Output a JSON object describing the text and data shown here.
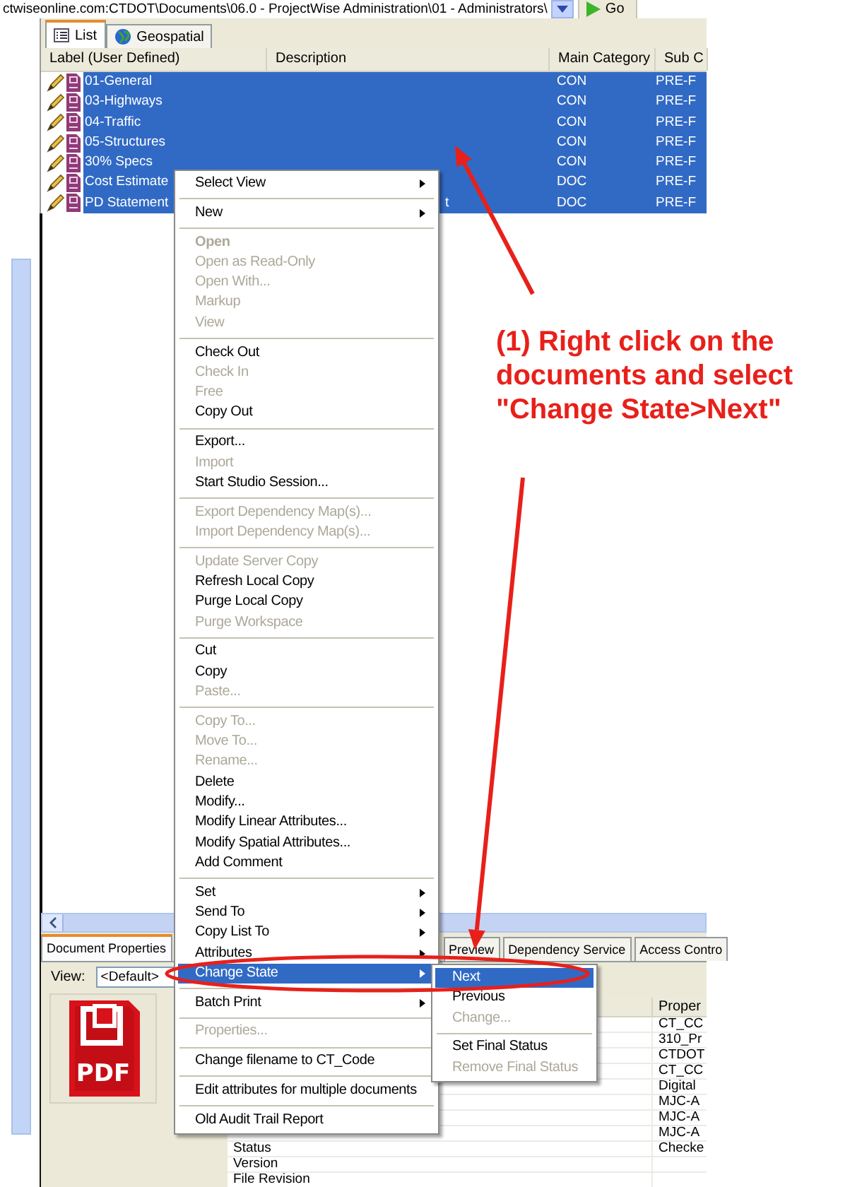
{
  "address_bar": {
    "path": "ctwiseonline.com:CTDOT\\Documents\\06.0 - ProjectWise Administration\\01 - Administrators\\",
    "go_label": "Go"
  },
  "view_tabs": [
    {
      "label": "List",
      "selected": true
    },
    {
      "label": "Geospatial",
      "selected": false
    }
  ],
  "document_list": {
    "columns": [
      "Label (User Defined)",
      "Description",
      "Main Category",
      "Sub C"
    ],
    "rows": [
      {
        "label": "01-General",
        "main_category": "CON",
        "sub_category": "PRE-F",
        "selected": true
      },
      {
        "label": "03-Highways",
        "main_category": "CON",
        "sub_category": "PRE-F",
        "selected": true
      },
      {
        "label": "04-Traffic",
        "main_category": "CON",
        "sub_category": "PRE-F",
        "selected": true
      },
      {
        "label": "05-Structures",
        "main_category": "CON",
        "sub_category": "PRE-F",
        "selected": true
      },
      {
        "label": "30% Specs",
        "main_category": "CON",
        "sub_category": "PRE-F",
        "selected": true
      },
      {
        "label": "Cost Estimate",
        "main_category": "DOC",
        "sub_category": "PRE-F",
        "selected": true
      },
      {
        "label": "PD Statement",
        "description": "t",
        "main_category": "DOC",
        "sub_category": "PRE-F",
        "selected": true
      }
    ]
  },
  "bottom_panel": {
    "tabs": [
      {
        "label": "Document Properties",
        "selected": true
      },
      {
        "label": "Preview",
        "selected": false
      },
      {
        "label": "Dependency Service",
        "selected": false
      },
      {
        "label": "Access Contro",
        "selected": false
      }
    ],
    "view": {
      "label": "View:",
      "value": "<Default>"
    },
    "preview_icon_label": "PDF",
    "properties": {
      "header": "Proper",
      "rows": [
        {
          "value": "CT_CC"
        },
        {
          "value": "310_Pr"
        },
        {
          "value": "CTDOT"
        },
        {
          "value": "CT_CC"
        },
        {
          "value": "Digital"
        },
        {
          "value": "MJC-A"
        },
        {
          "value": "MJC-A"
        },
        {
          "value": "MJC-A"
        },
        {
          "name": "Status",
          "value": "Checke"
        },
        {
          "name": "Version"
        },
        {
          "name": "File Revision"
        }
      ]
    }
  },
  "context_menu": {
    "items": [
      {
        "kind": "item",
        "label": "Select View",
        "disabled": false,
        "default": false,
        "submenu": true,
        "selected": false
      },
      {
        "kind": "separator"
      },
      {
        "kind": "item",
        "label": "New",
        "disabled": false,
        "default": false,
        "submenu": true,
        "selected": false
      },
      {
        "kind": "separator"
      },
      {
        "kind": "item",
        "label": "Open",
        "disabled": true,
        "default": true,
        "submenu": false,
        "selected": false
      },
      {
        "kind": "item",
        "label": "Open as Read-Only",
        "disabled": true,
        "default": false,
        "submenu": false,
        "selected": false
      },
      {
        "kind": "item",
        "label": "Open With...",
        "disabled": true,
        "default": false,
        "submenu": false,
        "selected": false
      },
      {
        "kind": "item",
        "label": "Markup",
        "disabled": true,
        "default": false,
        "submenu": false,
        "selected": false
      },
      {
        "kind": "item",
        "label": "View",
        "disabled": true,
        "default": false,
        "submenu": false,
        "selected": false
      },
      {
        "kind": "separator"
      },
      {
        "kind": "item",
        "label": "Check Out",
        "disabled": false,
        "default": false,
        "submenu": false,
        "selected": false
      },
      {
        "kind": "item",
        "label": "Check In",
        "disabled": true,
        "default": false,
        "submenu": false,
        "selected": false
      },
      {
        "kind": "item",
        "label": "Free",
        "disabled": true,
        "default": false,
        "submenu": false,
        "selected": false
      },
      {
        "kind": "item",
        "label": "Copy Out",
        "disabled": false,
        "default": false,
        "submenu": false,
        "selected": false
      },
      {
        "kind": "separator"
      },
      {
        "kind": "item",
        "label": "Export...",
        "disabled": false,
        "default": false,
        "submenu": false,
        "selected": false
      },
      {
        "kind": "item",
        "label": "Import",
        "disabled": true,
        "default": false,
        "submenu": false,
        "selected": false
      },
      {
        "kind": "item",
        "label": "Start Studio Session...",
        "disabled": false,
        "default": false,
        "submenu": false,
        "selected": false
      },
      {
        "kind": "separator"
      },
      {
        "kind": "item",
        "label": "Export Dependency Map(s)...",
        "disabled": true,
        "default": false,
        "submenu": false,
        "selected": false
      },
      {
        "kind": "item",
        "label": "Import Dependency Map(s)...",
        "disabled": true,
        "default": false,
        "submenu": false,
        "selected": false
      },
      {
        "kind": "separator"
      },
      {
        "kind": "item",
        "label": "Update Server Copy",
        "disabled": true,
        "default": false,
        "submenu": false,
        "selected": false
      },
      {
        "kind": "item",
        "label": "Refresh Local Copy",
        "disabled": false,
        "default": false,
        "submenu": false,
        "selected": false
      },
      {
        "kind": "item",
        "label": "Purge Local Copy",
        "disabled": false,
        "default": false,
        "submenu": false,
        "selected": false
      },
      {
        "kind": "item",
        "label": "Purge Workspace",
        "disabled": true,
        "default": false,
        "submenu": false,
        "selected": false
      },
      {
        "kind": "separator"
      },
      {
        "kind": "item",
        "label": "Cut",
        "disabled": false,
        "default": false,
        "submenu": false,
        "selected": false
      },
      {
        "kind": "item",
        "label": "Copy",
        "disabled": false,
        "default": false,
        "submenu": false,
        "selected": false
      },
      {
        "kind": "item",
        "label": "Paste...",
        "disabled": true,
        "default": false,
        "submenu": false,
        "selected": false
      },
      {
        "kind": "separator"
      },
      {
        "kind": "item",
        "label": "Copy To...",
        "disabled": true,
        "default": false,
        "submenu": false,
        "selected": false
      },
      {
        "kind": "item",
        "label": "Move To...",
        "disabled": true,
        "default": false,
        "submenu": false,
        "selected": false
      },
      {
        "kind": "item",
        "label": "Rename...",
        "disabled": true,
        "default": false,
        "submenu": false,
        "selected": false
      },
      {
        "kind": "item",
        "label": "Delete",
        "disabled": false,
        "default": false,
        "submenu": false,
        "selected": false
      },
      {
        "kind": "item",
        "label": "Modify...",
        "disabled": false,
        "default": false,
        "submenu": false,
        "selected": false
      },
      {
        "kind": "item",
        "label": "Modify Linear Attributes...",
        "disabled": false,
        "default": false,
        "submenu": false,
        "selected": false
      },
      {
        "kind": "item",
        "label": "Modify Spatial Attributes...",
        "disabled": false,
        "default": false,
        "submenu": false,
        "selected": false
      },
      {
        "kind": "item",
        "label": "Add Comment",
        "disabled": false,
        "default": false,
        "submenu": false,
        "selected": false
      },
      {
        "kind": "separator"
      },
      {
        "kind": "item",
        "label": "Set",
        "disabled": false,
        "default": false,
        "submenu": true,
        "selected": false
      },
      {
        "kind": "item",
        "label": "Send To",
        "disabled": false,
        "default": false,
        "submenu": true,
        "selected": false
      },
      {
        "kind": "item",
        "label": "Copy List To",
        "disabled": false,
        "default": false,
        "submenu": true,
        "selected": false
      },
      {
        "kind": "item",
        "label": "Attributes",
        "disabled": false,
        "default": false,
        "submenu": true,
        "selected": false
      },
      {
        "kind": "item",
        "label": "Change State",
        "disabled": false,
        "default": false,
        "submenu": true,
        "selected": true
      },
      {
        "kind": "separator"
      },
      {
        "kind": "item",
        "label": "Batch Print",
        "disabled": false,
        "default": false,
        "submenu": true,
        "selected": false
      },
      {
        "kind": "separator"
      },
      {
        "kind": "item",
        "label": "Properties...",
        "disabled": true,
        "default": false,
        "submenu": false,
        "selected": false
      },
      {
        "kind": "separator"
      },
      {
        "kind": "item",
        "label": "Change filename to CT_Code",
        "disabled": false,
        "default": false,
        "submenu": false,
        "selected": false
      },
      {
        "kind": "separator"
      },
      {
        "kind": "item",
        "label": "Edit attributes for multiple documents",
        "disabled": false,
        "default": false,
        "submenu": false,
        "selected": false
      },
      {
        "kind": "separator"
      },
      {
        "kind": "item",
        "label": "Old Audit Trail Report",
        "disabled": false,
        "default": false,
        "submenu": false,
        "selected": false
      }
    ]
  },
  "submenu": {
    "items": [
      {
        "kind": "item",
        "label": "Next",
        "disabled": false,
        "selected": true
      },
      {
        "kind": "item",
        "label": "Previous",
        "disabled": false,
        "selected": false
      },
      {
        "kind": "item",
        "label": "Change...",
        "disabled": true,
        "selected": false
      },
      {
        "kind": "separator"
      },
      {
        "kind": "item",
        "label": "Set Final Status",
        "disabled": false,
        "selected": false
      },
      {
        "kind": "item",
        "label": "Remove Final Status",
        "disabled": true,
        "selected": false
      }
    ]
  },
  "annotation": {
    "text": "(1) Right click on the documents and select \"Change State>Next\""
  }
}
